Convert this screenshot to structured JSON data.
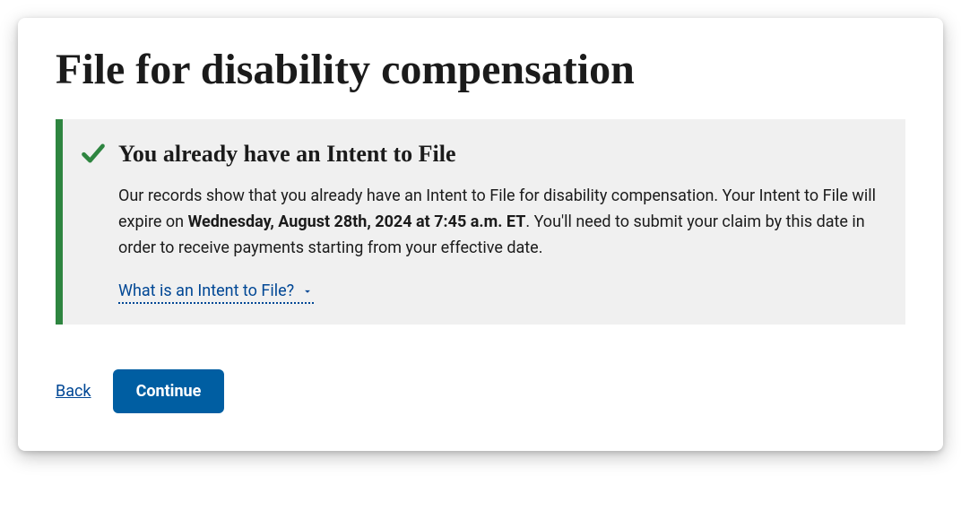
{
  "page": {
    "title": "File for disability compensation"
  },
  "alert": {
    "title": "You already have an Intent to File",
    "body_before": "Our records show that you already have an Intent to File for disability compensation. Your Intent to File will expire on ",
    "body_strong": "Wednesday, August 28th, 2024 at 7:45 a.m. ET",
    "body_after": ". You'll need to submit your claim by this date in order to receive payments starting from your effective date.",
    "expander_label": "What is an Intent to File?"
  },
  "nav": {
    "back_label": "Back",
    "continue_label": "Continue"
  },
  "colors": {
    "success_green": "#2e8540",
    "primary_blue": "#005ea2",
    "link_blue": "#004795"
  }
}
